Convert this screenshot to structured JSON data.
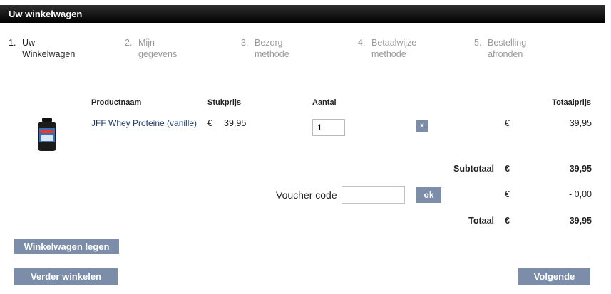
{
  "header": {
    "title": "Uw winkelwagen"
  },
  "steps": [
    {
      "num": "1.",
      "line1": "Uw",
      "line2": "Winkelwagen"
    },
    {
      "num": "2.",
      "line1": "Mijn",
      "line2": "gegevens"
    },
    {
      "num": "3.",
      "line1": "Bezorg",
      "line2": "methode"
    },
    {
      "num": "4.",
      "line1": "Betaalwijze",
      "line2": "methode"
    },
    {
      "num": "5.",
      "line1": "Bestelling",
      "line2": "afronden"
    }
  ],
  "table": {
    "headers": {
      "product": "Productnaam",
      "unit_price": "Stukprijs",
      "quantity": "Aantal",
      "total": "Totaalprijs"
    },
    "row": {
      "name": "JFF Whey Proteine (vanille)",
      "currency": "€",
      "unit_price": "39,95",
      "quantity": "1",
      "remove": "x",
      "total": "39,95"
    }
  },
  "summary": {
    "subtotal_label": "Subtotaal",
    "subtotal_currency": "€",
    "subtotal_value": "39,95",
    "voucher_label": "Voucher code",
    "voucher_value": "",
    "voucher_button": "ok",
    "discount_currency": "€",
    "discount_value": "- 0,00",
    "total_label": "Totaal",
    "total_currency": "€",
    "total_value": "39,95"
  },
  "buttons": {
    "empty_cart": "Winkelwagen legen",
    "continue_shopping": "Verder winkelen",
    "next": "Volgende"
  },
  "colors": {
    "header_bg": "#000000",
    "button_bg": "#7b8da8",
    "link": "#1a3a6e"
  }
}
